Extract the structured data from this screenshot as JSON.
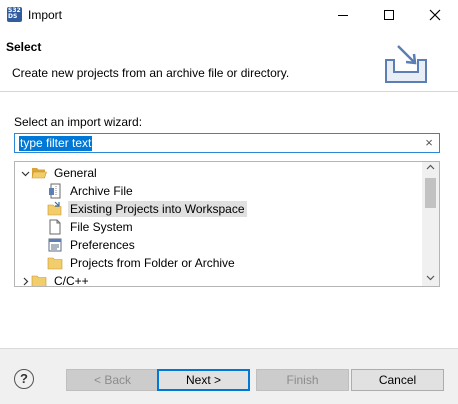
{
  "window": {
    "title": "Import",
    "icon_text": "S32\nDS",
    "controls": [
      "minimize-icon",
      "maximize-icon",
      "close-icon"
    ]
  },
  "banner": {
    "title": "Select",
    "description": "Create new projects from an archive file or directory.",
    "image": "import-wizard-banner-icon"
  },
  "wizard": {
    "label": "Select an import wizard:",
    "filter": {
      "value": "type filter text",
      "clear_glyph": "×"
    },
    "tree": [
      {
        "label": "General",
        "expanded": true,
        "icon": "folder-open-icon",
        "chevron": "v",
        "selected": false
      },
      {
        "label": "Archive File",
        "icon": "archive-icon",
        "selected": false
      },
      {
        "label": "Existing Projects into Workspace",
        "icon": "existing-project-icon",
        "selected": true
      },
      {
        "label": "File System",
        "icon": "file-system-icon",
        "selected": false
      },
      {
        "label": "Preferences",
        "icon": "preferences-icon",
        "selected": false
      },
      {
        "label": "Projects from Folder or Archive",
        "icon": "folder-icon",
        "selected": false
      },
      {
        "label": "C/C++",
        "expanded": false,
        "icon": "folder-icon",
        "chevron": ">",
        "selected": false
      }
    ]
  },
  "footer": {
    "help_glyph": "?",
    "back_label": "< Back",
    "next_label": "Next >",
    "finish_label": "Finish",
    "cancel_label": "Cancel"
  },
  "colors": {
    "accent": "#0078d7",
    "folder": "#e8b84a",
    "selection": "#e0e0e0",
    "footer_bg": "#f0f0f0"
  }
}
